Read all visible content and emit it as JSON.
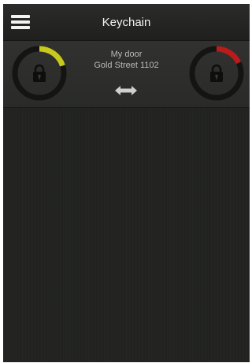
{
  "header": {
    "title": "Keychain",
    "menu_icon": "hamburger-menu-icon"
  },
  "key": {
    "name": "My door",
    "address": "Gold Street 1102",
    "left_dial": {
      "icon": "lock-icon",
      "arc_color": "#c7c91c",
      "progress": 0.2
    },
    "right_dial": {
      "icon": "lock-icon",
      "arc_color": "#b81c1c",
      "progress": 0.18
    },
    "swap_icon": "double-arrow-icon"
  },
  "colors": {
    "background": "#222321",
    "navbar": "#252624",
    "text_primary": "#f4f4f4",
    "text_secondary": "#b9bab7"
  }
}
